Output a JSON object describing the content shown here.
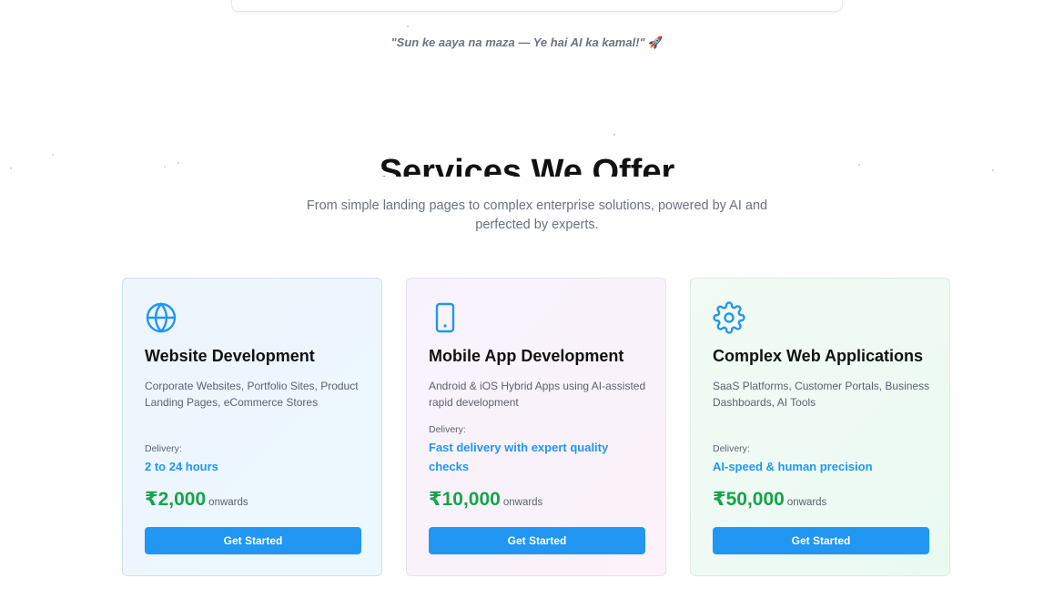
{
  "hero": {
    "tagline": "\"Sun ke aaya na maza — Ye hai AI ka kamal!\"",
    "tagline_emoji_icon": "rocket-icon"
  },
  "services": {
    "heading": "Services We Offer",
    "subtitle": "From simple landing pages to complex enterprise solutions, powered by AI and perfected by experts.",
    "accent_color": "#2196f3",
    "price_color": "#16a34a",
    "cards": [
      {
        "icon": "globe-icon",
        "title": "Website Development",
        "description": "Corporate Websites, Portfolio Sites, Product Landing Pages, eCommerce Stores",
        "delivery_label": "Delivery:",
        "delivery_value": "2 to 24 hours",
        "price": "₹2,000",
        "price_suffix": "onwards",
        "button_label": "Get Started"
      },
      {
        "icon": "smartphone-icon",
        "title": "Mobile App Development",
        "description": "Android & iOS Hybrid Apps using AI-assisted rapid development",
        "delivery_label": "Delivery:",
        "delivery_value": "Fast delivery with expert quality checks",
        "price": "₹10,000",
        "price_suffix": "onwards",
        "button_label": "Get Started"
      },
      {
        "icon": "gear-icon",
        "title": "Complex Web Applications",
        "description": "SaaS Platforms, Customer Portals, Business Dashboards, AI Tools",
        "delivery_label": "Delivery:",
        "delivery_value": "AI-speed & human precision",
        "price": "₹50,000",
        "price_suffix": "onwards",
        "button_label": "Get Started"
      }
    ]
  }
}
